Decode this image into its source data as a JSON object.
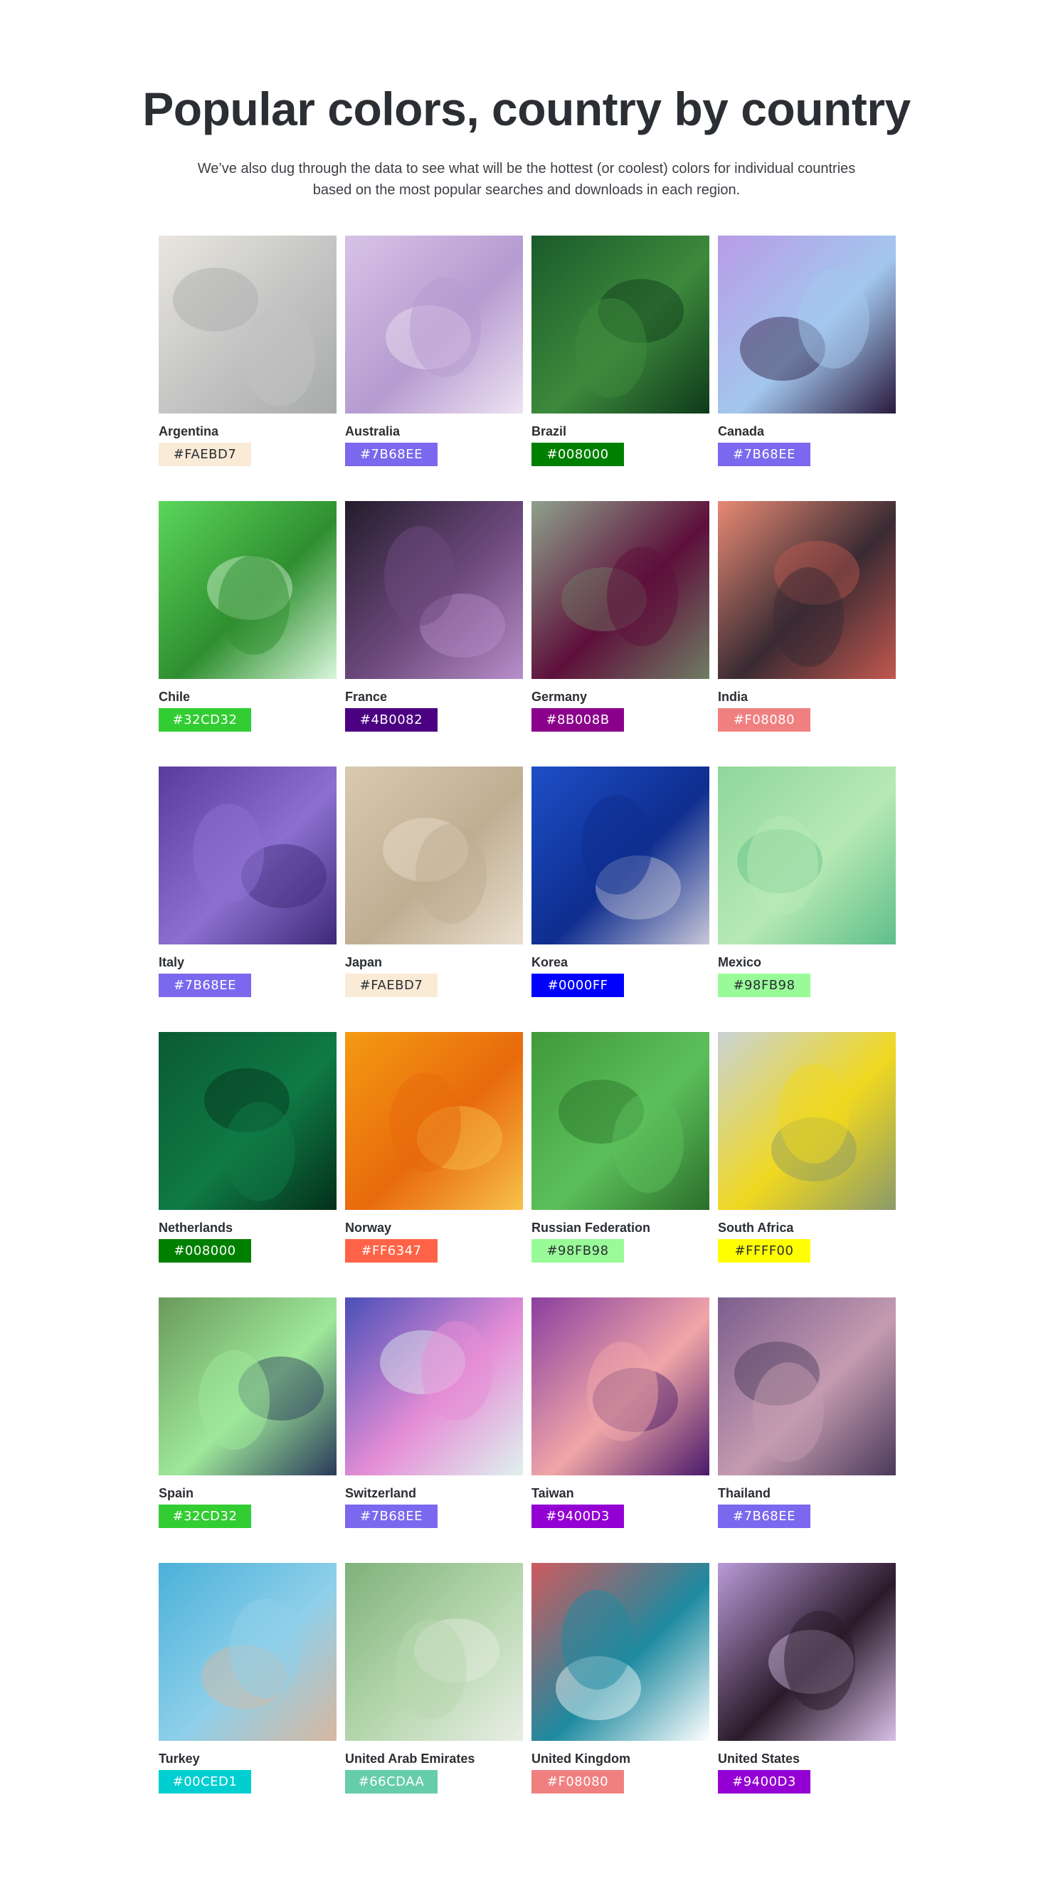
{
  "header": {
    "title": "Popular colors, country by country",
    "subtitle": "We’ve also dug through the data to see what will be the hottest (or coolest) colors for individual countries based on the most popular searches and downloads in each region."
  },
  "countries": [
    {
      "name": "Argentina",
      "hex": "#FAEBD7",
      "text_color": "#2b2e33",
      "photo_icon": "white-stairs-photo",
      "photo_colors": [
        "#e9e6df",
        "#c2c3c2",
        "#a9abab"
      ]
    },
    {
      "name": "Australia",
      "hex": "#7B68EE",
      "text_color": "#ffffff",
      "photo_icon": "pink-salt-lake-photo",
      "photo_colors": [
        "#d8c3e6",
        "#b59bd0",
        "#efe3f2"
      ]
    },
    {
      "name": "Brazil",
      "hex": "#008000",
      "text_color": "#ffffff",
      "photo_icon": "green-leaves-photo",
      "photo_colors": [
        "#1b5a2b",
        "#3d8a3c",
        "#0f3a1b"
      ]
    },
    {
      "name": "Canada",
      "hex": "#7B68EE",
      "text_color": "#ffffff",
      "photo_icon": "runner-jumping-photo",
      "photo_colors": [
        "#b89ce6",
        "#a3c7ee",
        "#2a1a3d"
      ]
    },
    {
      "name": "Chile",
      "hex": "#32CD32",
      "text_color": "#ffffff",
      "photo_icon": "green-plant-illustration",
      "photo_colors": [
        "#5bd65b",
        "#2f8f2f",
        "#d9f7dc"
      ]
    },
    {
      "name": "France",
      "hex": "#4B0082",
      "text_color": "#ffffff",
      "photo_icon": "eggplants-bowl-photo",
      "photo_colors": [
        "#231c2b",
        "#6e4a7e",
        "#b88fc9"
      ]
    },
    {
      "name": "Germany",
      "hex": "#8B008B",
      "text_color": "#ffffff",
      "photo_icon": "cactus-fruit-photo",
      "photo_colors": [
        "#8fa28c",
        "#5e0f3b",
        "#6f7d63"
      ]
    },
    {
      "name": "India",
      "hex": "#F08080",
      "text_color": "#ffffff",
      "photo_icon": "coral-canyon-photo",
      "photo_colors": [
        "#e88a74",
        "#3a2a33",
        "#c2584e"
      ]
    },
    {
      "name": "Italy",
      "hex": "#7B68EE",
      "text_color": "#ffffff",
      "photo_icon": "lavender-field-photo",
      "photo_colors": [
        "#5a3b9c",
        "#8c6fd0",
        "#3e2a78"
      ]
    },
    {
      "name": "Japan",
      "hex": "#FAEBD7",
      "text_color": "#2b2e33",
      "photo_icon": "egg-on-linen-photo",
      "photo_colors": [
        "#d8c9b0",
        "#bfae92",
        "#eae0cf"
      ]
    },
    {
      "name": "Korea",
      "hex": "#0000FF",
      "text_color": "#ffffff",
      "photo_icon": "blue-fabric-photo",
      "photo_colors": [
        "#1d4fc7",
        "#0e2d8f",
        "#c8c7d8"
      ]
    },
    {
      "name": "Mexico",
      "hex": "#98FB98",
      "text_color": "#2b2e33",
      "photo_icon": "green-triangles-pattern",
      "photo_colors": [
        "#8fd79a",
        "#b7e9b4",
        "#5fbf8a"
      ]
    },
    {
      "name": "Netherlands",
      "hex": "#008000",
      "text_color": "#ffffff",
      "photo_icon": "diver-underwater-photo",
      "photo_colors": [
        "#0b5a32",
        "#0f7a45",
        "#04301a"
      ]
    },
    {
      "name": "Norway",
      "hex": "#FF6347",
      "text_color": "#ffffff",
      "photo_icon": "orange-panels-photo",
      "photo_colors": [
        "#f49a12",
        "#e86a0c",
        "#f7c24a"
      ]
    },
    {
      "name": "Russian Federation",
      "hex": "#98FB98",
      "text_color": "#2b2e33",
      "photo_icon": "woman-in-grass-photo",
      "photo_colors": [
        "#3f9a3a",
        "#5cc05a",
        "#2a6e2a"
      ]
    },
    {
      "name": "South Africa",
      "hex": "#FFFF00",
      "text_color": "#2b2e33",
      "photo_icon": "yellow-bird-flowers-photo",
      "photo_colors": [
        "#c9d3d6",
        "#f0d820",
        "#8a9a6a"
      ]
    },
    {
      "name": "Spain",
      "hex": "#32CD32",
      "text_color": "#ffffff",
      "photo_icon": "couple-green-wall-photo",
      "photo_colors": [
        "#6a9a5a",
        "#9ee89a",
        "#2a3a5a"
      ]
    },
    {
      "name": "Switzerland",
      "hex": "#7B68EE",
      "text_color": "#ffffff",
      "photo_icon": "purple-palm-leaf-photo",
      "photo_colors": [
        "#4a4fb8",
        "#e58ed6",
        "#dff2ef"
      ]
    },
    {
      "name": "Taiwan",
      "hex": "#9400D3",
      "text_color": "#ffffff",
      "photo_icon": "purple-tent-night-illustration",
      "photo_colors": [
        "#8a3fa0",
        "#f0a6a8",
        "#4a1a6a"
      ]
    },
    {
      "name": "Thailand",
      "hex": "#7B68EE",
      "text_color": "#ffffff",
      "photo_icon": "sunset-beach-photo",
      "photo_colors": [
        "#7c5e8e",
        "#c49bb0",
        "#4a3a5a"
      ]
    },
    {
      "name": "Turkey",
      "hex": "#00CED1",
      "text_color": "#ffffff",
      "photo_icon": "blue-terraces-photo",
      "photo_colors": [
        "#4ab0d8",
        "#8fd0ea",
        "#d8b7a0"
      ]
    },
    {
      "name": "United Arab Emirates",
      "hex": "#66CDAA",
      "text_color": "#ffffff",
      "photo_icon": "green-painted-hands-photo",
      "photo_colors": [
        "#7fb27a",
        "#b8d8b0",
        "#e8ede5"
      ]
    },
    {
      "name": "United Kingdom",
      "hex": "#F08080",
      "text_color": "#ffffff",
      "photo_icon": "tennis-court-aerial-photo",
      "photo_colors": [
        "#cf5a5e",
        "#1e8aa0",
        "#ffffff"
      ]
    },
    {
      "name": "United States",
      "hex": "#9400D3",
      "text_color": "#ffffff",
      "photo_icon": "woman-curly-hair-photo",
      "photo_colors": [
        "#b99bd8",
        "#2a1a2a",
        "#d8c0e8"
      ]
    }
  ]
}
